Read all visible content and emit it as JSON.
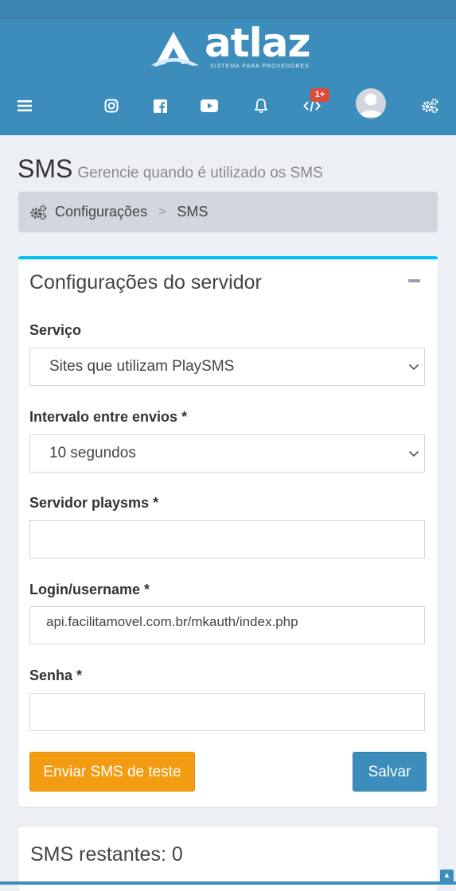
{
  "brand": {
    "name": "atlaz",
    "tagline": "SISTEMA PARA PROVEDORES"
  },
  "navbar": {
    "icons": [
      "menu-icon",
      "instagram-icon",
      "facebook-icon",
      "youtube-icon",
      "bell-icon",
      "code-icon",
      "user-avatar",
      "gears-icon"
    ],
    "code_badge": "1+"
  },
  "header": {
    "title": "SMS",
    "subtitle": "Gerencie quando é utilizado os SMS"
  },
  "breadcrumb": {
    "items": [
      "Configurações",
      "SMS"
    ],
    "separator": ">"
  },
  "server_box": {
    "title": "Configurações do servidor",
    "service_label": "Serviço",
    "service_value": "Sites que utilizam PlaySMS",
    "interval_label": "Intervalo entre envios *",
    "interval_value": "10 segundos",
    "server_label": "Servidor playsms *",
    "server_value": "",
    "login_label": "Login/username *",
    "login_value": "api.facilitamovel.com.br/mkauth/index.php",
    "password_label": "Senha *",
    "password_value": "",
    "test_button": "Enviar SMS de teste",
    "save_button": "Salvar"
  },
  "sms_box": {
    "title": "SMS restantes: 0"
  },
  "colors": {
    "primary": "#3c8dbc",
    "accent": "#00c0ef",
    "warning": "#f39c12",
    "danger": "#dd4b39"
  }
}
